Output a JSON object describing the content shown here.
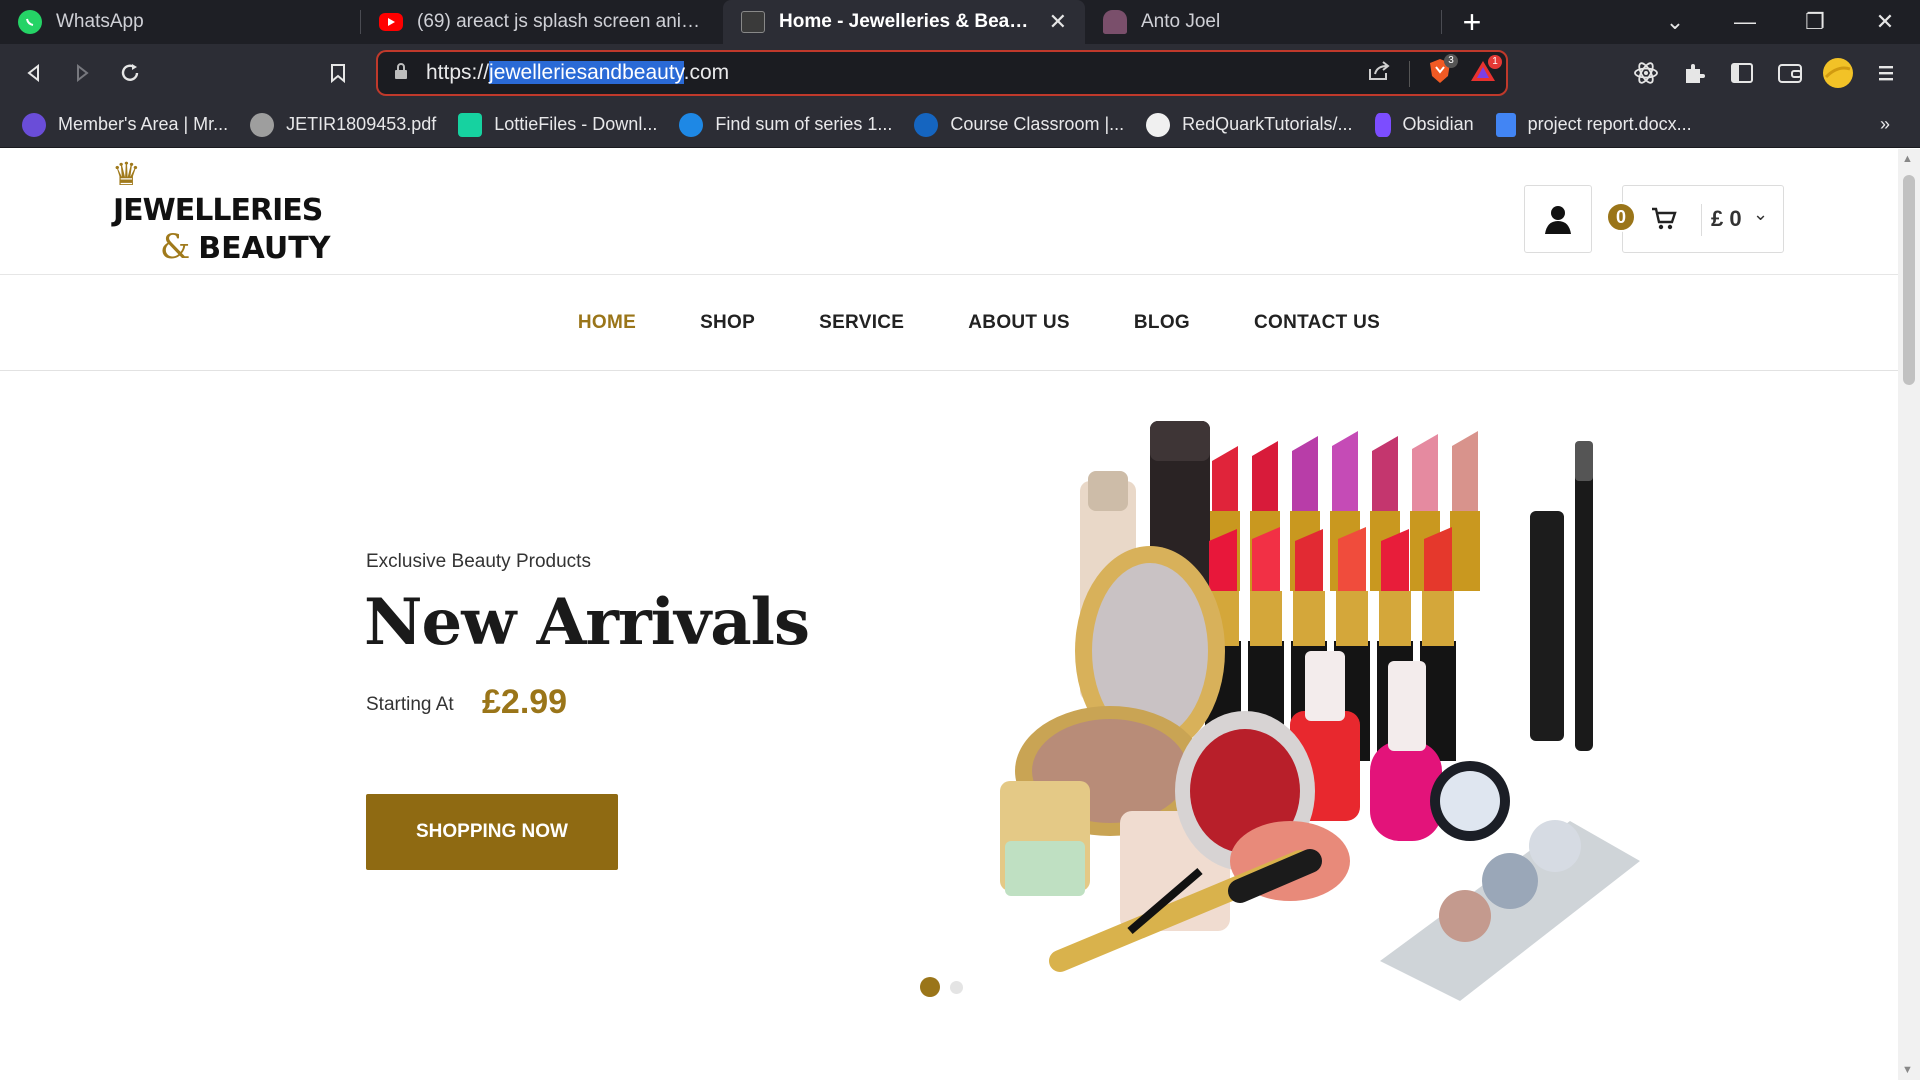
{
  "browser": {
    "tabs": [
      {
        "title": "WhatsApp",
        "active": false
      },
      {
        "title": "(69) areact js splash screen animation",
        "active": false
      },
      {
        "title": "Home - Jewelleries & Beauty",
        "active": true
      },
      {
        "title": "Anto Joel",
        "active": false
      }
    ],
    "url_prefix": "https://",
    "url_selected": "jewelleriesandbeauty",
    "url_suffix": ".com",
    "shield_badge": "3",
    "alert_badge": "1",
    "bookmarks": [
      {
        "label": "Member's Area | Mr...",
        "color": "#6a4dd8"
      },
      {
        "label": "JETIR1809453.pdf",
        "color": "#9e9e9e"
      },
      {
        "label": "LottieFiles - Downl...",
        "color": "#16d2a0"
      },
      {
        "label": "Find sum of series 1...",
        "color": "#1e88e5"
      },
      {
        "label": "Course Classroom |...",
        "color": "#1565c0"
      },
      {
        "label": "RedQuarkTutorials/...",
        "color": "#f0f0f0"
      },
      {
        "label": "Obsidian",
        "color": "#7c4dff"
      },
      {
        "label": "project report.docx...",
        "color": "#4285f4"
      }
    ]
  },
  "site": {
    "logo": {
      "line1": "JEWELLERIES",
      "amp": "&",
      "line2": "BEAUTY"
    },
    "cart_count": "0",
    "cart_total": "£ 0",
    "nav": [
      "HOME",
      "SHOP",
      "SERVICE",
      "ABOUT US",
      "BLOG",
      "CONTACT US"
    ],
    "hero": {
      "subtitle": "Exclusive Beauty Products",
      "title": "New Arrivals",
      "starting_label": "Starting At",
      "price": "£2.99",
      "button": "SHOPPING NOW"
    }
  },
  "colors": {
    "accent": "#9a7519",
    "button": "#8f6a12"
  }
}
